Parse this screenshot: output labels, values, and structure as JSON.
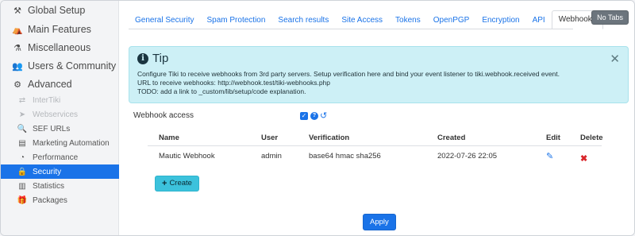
{
  "sidebar": {
    "items": [
      {
        "label": "Global Setup",
        "icon": "wrench-icon",
        "glyph": "⚒"
      },
      {
        "label": "Main Features",
        "icon": "features-icon",
        "glyph": "⛺"
      },
      {
        "label": "Miscellaneous",
        "icon": "flask-icon",
        "glyph": "⚗"
      },
      {
        "label": "Users & Community",
        "icon": "users-icon",
        "glyph": "👥"
      },
      {
        "label": "Advanced",
        "icon": "gears-icon",
        "glyph": "⚙"
      }
    ],
    "sub_items": [
      {
        "label": "InterTiki",
        "icon": "exchange-icon",
        "glyph": "⇄"
      },
      {
        "label": "Webservices",
        "icon": "cursor-icon",
        "glyph": "➤"
      },
      {
        "label": "SEF URLs",
        "icon": "search-icon",
        "glyph": "🔍"
      },
      {
        "label": "Marketing Automation",
        "icon": "clipboard-icon",
        "glyph": "▤"
      },
      {
        "label": "Performance",
        "icon": "tachometer-icon",
        "glyph": "◔"
      },
      {
        "label": "Security",
        "icon": "lock-icon",
        "glyph": "🔒"
      },
      {
        "label": "Statistics",
        "icon": "chart-icon",
        "glyph": "▥"
      },
      {
        "label": "Packages",
        "icon": "gift-icon",
        "glyph": "🎁"
      }
    ]
  },
  "tabs": [
    "General Security",
    "Spam Protection",
    "Search results",
    "Site Access",
    "Tokens",
    "OpenPGP",
    "Encryption",
    "API",
    "Webhooks"
  ],
  "active_tab": "Webhooks",
  "no_tabs_label": "No Tabs",
  "tip": {
    "title": "Tip",
    "lines": [
      "Configure Tiki to receive webhooks from 3rd party servers. Setup verification here and bind your event listener to tiki.webhook.received event.",
      "URL to receive webhooks: http://webhook.test/tiki-webhooks.php",
      "TODO: add a link to _custom/lib/setup/code explanation."
    ],
    "close_glyph": "✕"
  },
  "webhook_access": {
    "label": "Webhook access",
    "checked": true
  },
  "table": {
    "headers": {
      "name": "Name",
      "user": "User",
      "verification": "Verification",
      "created": "Created",
      "edit": "Edit",
      "delete": "Delete"
    },
    "rows": [
      {
        "name": "Mautic Webhook",
        "user": "admin",
        "verification": "base64 hmac sha256",
        "created": "2022-07-26 22:05"
      }
    ]
  },
  "buttons": {
    "create": "Create",
    "apply": "Apply"
  },
  "colors": {
    "accent": "#1a73e8",
    "tip_bg": "#cdf0f6",
    "create_bg": "#3cc2dc",
    "delete": "#d9262b"
  }
}
